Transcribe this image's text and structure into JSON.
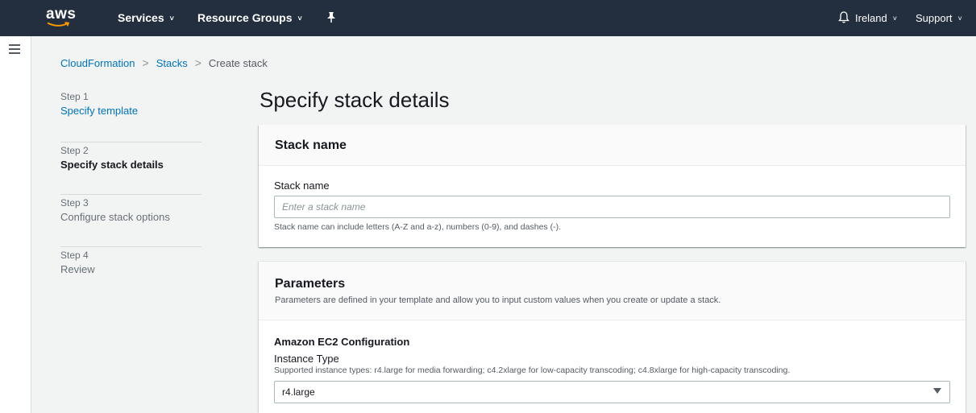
{
  "nav": {
    "logo": "aws",
    "services": "Services",
    "resource_groups": "Resource Groups",
    "pin_icon": "pin-icon",
    "bell_icon": "bell-icon",
    "region": "Ireland",
    "support": "Support",
    "background": "#232f3e"
  },
  "breadcrumb": {
    "items": [
      "CloudFormation",
      "Stacks",
      "Create stack"
    ],
    "separator": ">"
  },
  "steps": [
    {
      "num": "Step 1",
      "title": "Specify template",
      "state": "link"
    },
    {
      "num": "Step 2",
      "title": "Specify stack details",
      "state": "active"
    },
    {
      "num": "Step 3",
      "title": "Configure stack options",
      "state": "disabled"
    },
    {
      "num": "Step 4",
      "title": "Review",
      "state": "disabled"
    }
  ],
  "page_title": "Specify stack details",
  "stack_name_panel": {
    "title": "Stack name",
    "field_label": "Stack name",
    "placeholder": "Enter a stack name",
    "value": "",
    "hint": "Stack name can include letters (A-Z and a-z), numbers (0-9), and dashes (-)."
  },
  "parameters_panel": {
    "title": "Parameters",
    "description": "Parameters are defined in your template and allow you to input custom values when you create or update a stack.",
    "section": "Amazon EC2 Configuration",
    "field_label": "Instance Type",
    "field_hint": "Supported instance types: r4.large for media forwarding; c4.2xlarge for low-capacity transcoding; c4.8xlarge for high-capacity transcoding.",
    "selected": "r4.large"
  },
  "colors": {
    "link": "#0073bb",
    "text": "#16191f",
    "muted": "#687078",
    "page_bg": "#f2f3f3"
  }
}
